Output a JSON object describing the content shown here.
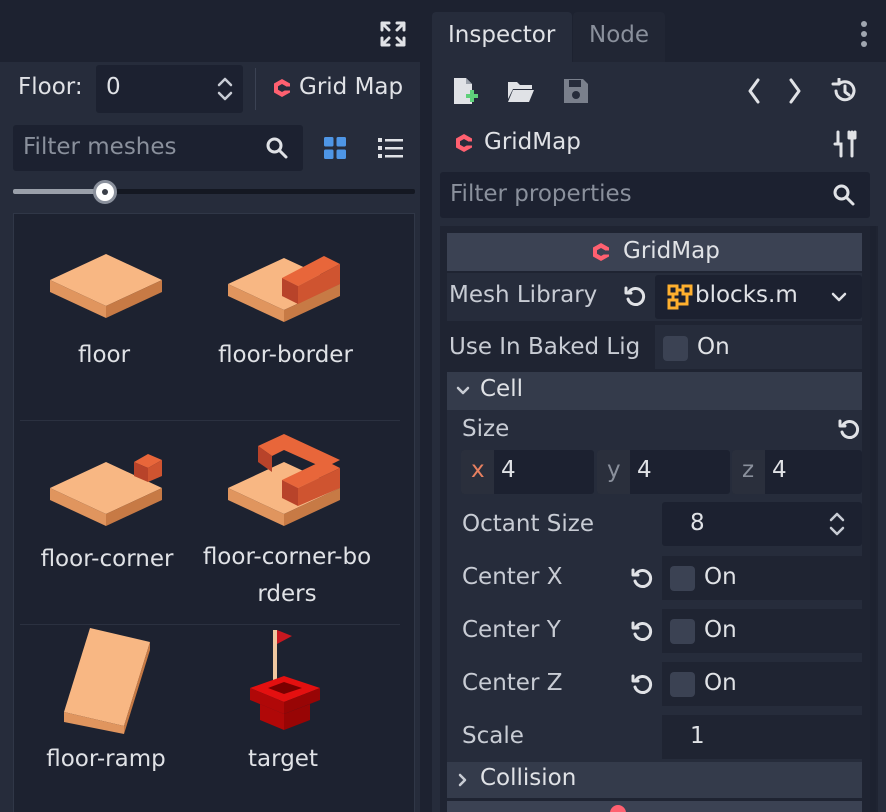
{
  "colors": {
    "bg": "#1d2230",
    "panel": "#262c3b",
    "field": "#1c2130",
    "accent": "#4e96e6",
    "godot_red": "#ff6070",
    "text": "#e0e2e6"
  },
  "left_panel": {
    "fullscreen_icon": "expand-icon",
    "floor_label": "Floor:",
    "floor_value": "0",
    "gridmap_label": "Grid Map",
    "filter_placeholder": "Filter meshes",
    "zoom_level": 0.4,
    "meshes": [
      {
        "label": "floor",
        "label_line2": ""
      },
      {
        "label": "floor-border",
        "label_line2": ""
      },
      {
        "label": "floor-corner",
        "label_line2": ""
      },
      {
        "label": "floor-corner-bo",
        "label_line2": "rders"
      },
      {
        "label": "floor-ramp",
        "label_line2": ""
      },
      {
        "label": "target",
        "label_line2": ""
      }
    ]
  },
  "inspector": {
    "tabs": [
      "Inspector",
      "Node"
    ],
    "active_tab": "Inspector",
    "node_name": "GridMap",
    "filter_placeholder": "Filter properties",
    "section_title": "GridMap",
    "mesh_library_label": "Mesh Library",
    "mesh_library_value": "blocks.m",
    "use_baked_label": "Use In Baked Lig",
    "use_baked_value": "On",
    "cell_section": "Cell",
    "size_label": "Size",
    "size": {
      "x_label": "x",
      "x": "4",
      "y_label": "y",
      "y": "4",
      "z_label": "z",
      "z": "4"
    },
    "octant_label": "Octant Size",
    "octant_value": "8",
    "center_x_label": "Center X",
    "center_x_value": "On",
    "center_y_label": "Center Y",
    "center_y_value": "On",
    "center_z_label": "Center Z",
    "center_z_value": "On",
    "scale_label": "Scale",
    "scale_value": "1",
    "collision_section": "Collision"
  }
}
